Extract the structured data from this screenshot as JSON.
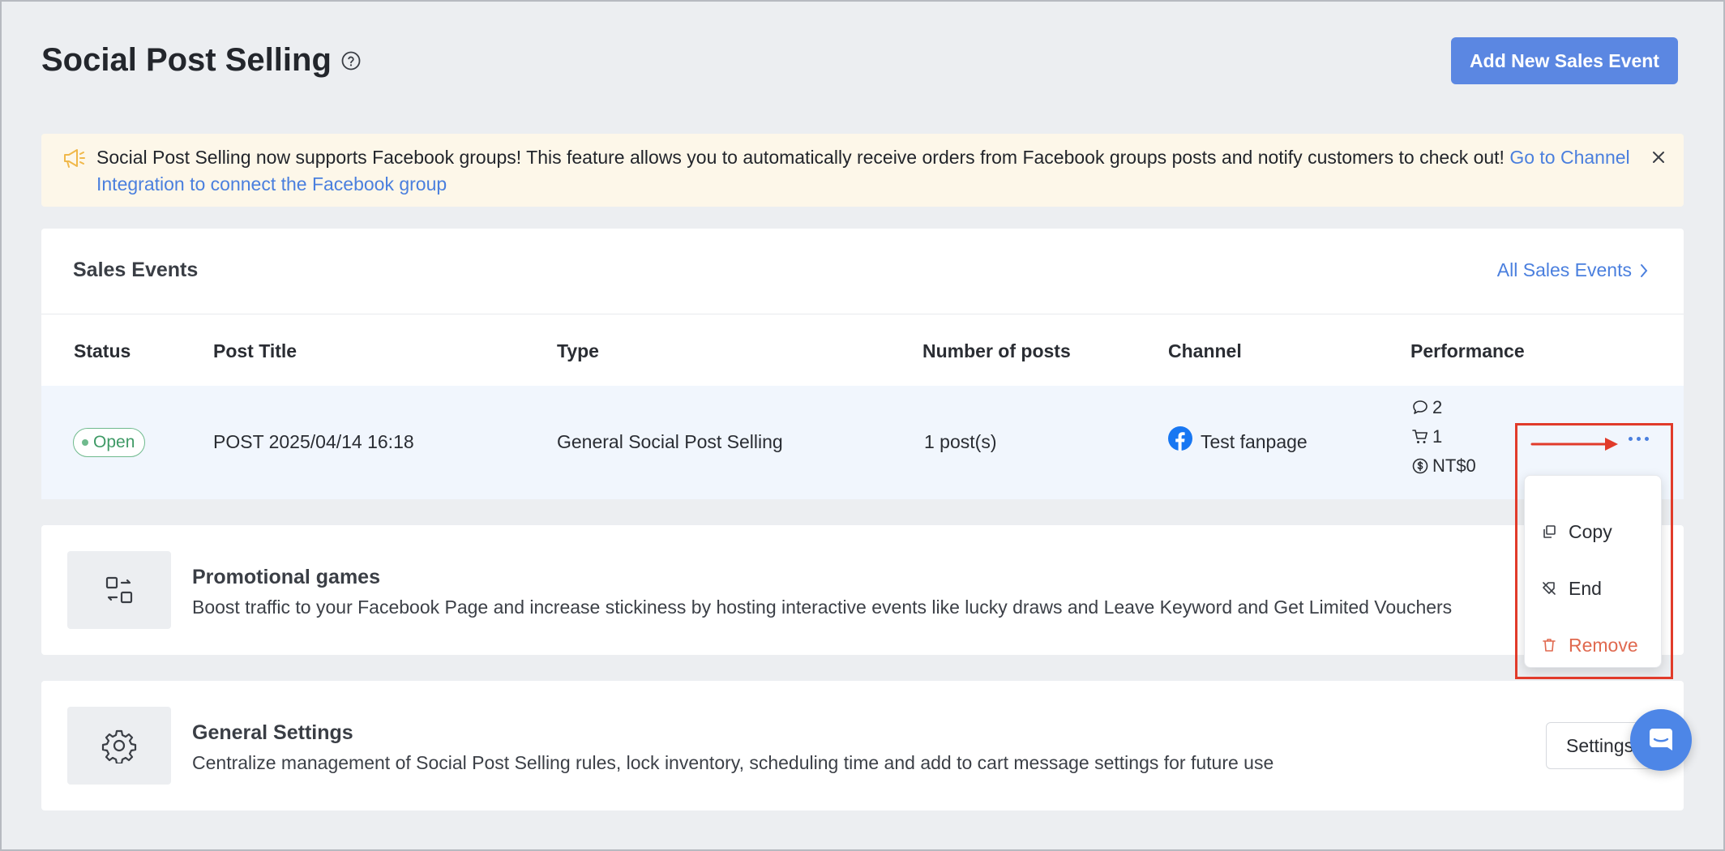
{
  "page": {
    "title": "Social Post Selling",
    "add_button": "Add New Sales Event"
  },
  "notice": {
    "text": "Social Post Selling now supports Facebook groups! This feature allows you to automatically receive orders from Facebook groups posts and notify customers to check out! ",
    "link": "Go to Channel Integration to connect the Facebook group"
  },
  "sales_events": {
    "title": "Sales Events",
    "all_link": "All Sales Events",
    "columns": [
      "Status",
      "Post Title",
      "Type",
      "Number of posts",
      "Channel",
      "Performance"
    ],
    "rows": [
      {
        "status": "Open",
        "post_title": "POST 2025/04/14 16:18",
        "type": "General Social Post Selling",
        "num_posts": "1 post(s)",
        "channel": "Test fanpage",
        "comments": "2",
        "orders": "1",
        "revenue": "NT$0"
      }
    ]
  },
  "row_menu": {
    "items": [
      "Copy",
      "End",
      "Remove"
    ]
  },
  "promotional_games": {
    "title": "Promotional games",
    "description": "Boost traffic to your Facebook Page and increase stickiness by hosting interactive events like lucky draws and Leave Keyword and Get Limited Vouchers"
  },
  "general_settings": {
    "title": "General Settings",
    "description": "Centralize management of Social Post Selling rules, lock inventory, scheduling time and add to cart message settings for future use",
    "button": "Settings"
  },
  "colors": {
    "primary": "#5b87e2",
    "link": "#4a7fde",
    "annotation": "#e13b2a",
    "danger": "#e0694f",
    "success": "#3f9a66"
  }
}
